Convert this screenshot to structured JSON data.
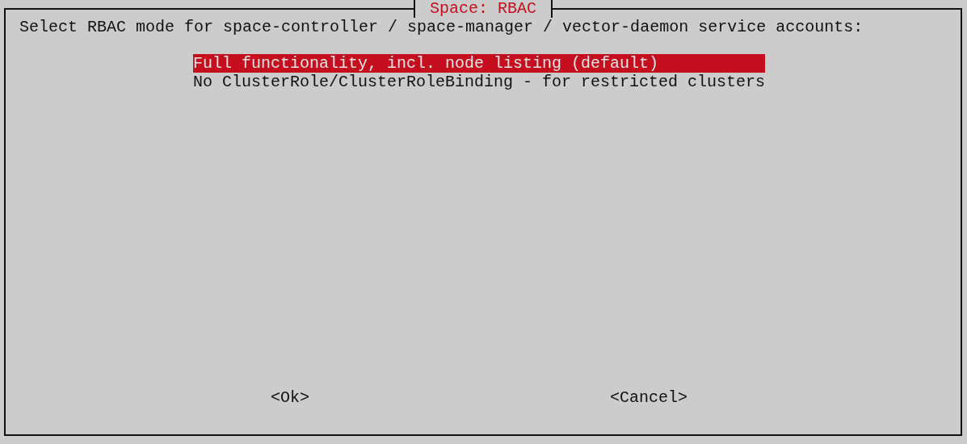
{
  "dialog": {
    "title": "Space: RBAC",
    "prompt": "Select RBAC mode for space-controller / space-manager / vector-daemon service accounts:",
    "items": [
      {
        "label": "Full functionality, incl. node listing (default)",
        "selected": true
      },
      {
        "label": "No ClusterRole/ClusterRoleBinding - for restricted clusters",
        "selected": false
      }
    ],
    "buttons": [
      {
        "label": "<Ok>"
      },
      {
        "label": "<Cancel>"
      }
    ]
  }
}
